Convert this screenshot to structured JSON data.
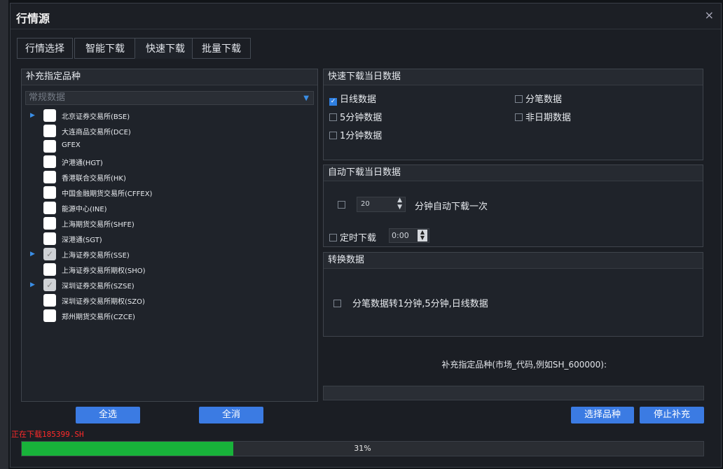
{
  "title": "行情源",
  "close_icon": "×",
  "tabs": [
    {
      "label": "行情选择"
    },
    {
      "label": "智能下载"
    },
    {
      "label": "快速下载"
    },
    {
      "label": "批量下载"
    }
  ],
  "left_panel": {
    "title": "补充指定品种",
    "combo_value": "常规数据",
    "items": [
      {
        "label": "北京证券交易所(BSE)",
        "expandable": true,
        "checked": false
      },
      {
        "label": "大连商品交易所(DCE)",
        "expandable": false,
        "checked": false
      },
      {
        "label": "GFEX",
        "expandable": false,
        "checked": false
      },
      {
        "label": "沪港通(HGT)",
        "expandable": false,
        "checked": false
      },
      {
        "label": "香港联合交易所(HK)",
        "expandable": false,
        "checked": false
      },
      {
        "label": "中国金融期货交易所(CFFEX)",
        "expandable": false,
        "checked": false
      },
      {
        "label": "能源中心(INE)",
        "expandable": false,
        "checked": false
      },
      {
        "label": "上海期货交易所(SHFE)",
        "expandable": false,
        "checked": false
      },
      {
        "label": "深港通(SGT)",
        "expandable": false,
        "checked": false
      },
      {
        "label": "上海证券交易所(SSE)",
        "expandable": true,
        "checked": true
      },
      {
        "label": "上海证券交易所期权(SHO)",
        "expandable": false,
        "checked": false
      },
      {
        "label": "深圳证券交易所(SZSE)",
        "expandable": true,
        "checked": true
      },
      {
        "label": "深圳证券交易所期权(SZO)",
        "expandable": false,
        "checked": false
      },
      {
        "label": "郑州期货交易所(CZCE)",
        "expandable": false,
        "checked": false
      }
    ],
    "select_all": "全选",
    "deselect_all": "全消"
  },
  "quick_panel": {
    "title": "快速下载当日数据",
    "daily": "日线数据",
    "tick": "分笔数据",
    "min5": "5分钟数据",
    "nondate": "非日期数据",
    "min1": "1分钟数据"
  },
  "auto_panel": {
    "title": "自动下载当日数据",
    "interval_value": "20",
    "interval_label": "分钟自动下载一次",
    "timer_label": "定时下载",
    "timer_value": "0:00"
  },
  "convert_panel": {
    "title": "转换数据",
    "option": "分笔数据转1分钟,5分钟,日线数据"
  },
  "supplement_hint": "补充指定品种(市场_代码,例如SH_600000):",
  "select_variety": "选择品种",
  "stop_supplement": "停止补充",
  "status_text": "正在下载185399.SH",
  "progress": {
    "percent": 31,
    "label": "31%"
  },
  "colors": {
    "accent": "#3b7be3",
    "progress": "#18b23a",
    "status": "#ff2a2a"
  }
}
